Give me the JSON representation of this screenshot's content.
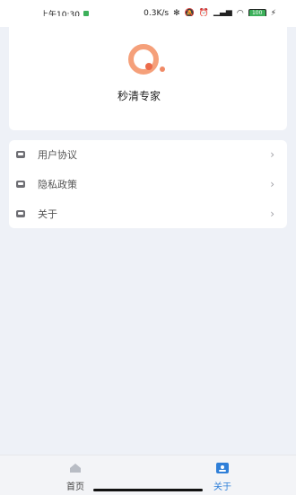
{
  "status_bar": {
    "time": "上午10:30",
    "net_speed": "0.3K/s",
    "battery": "100"
  },
  "app": {
    "name": "秒清专家",
    "brand_color": "#f5a07a"
  },
  "menu": {
    "items": [
      {
        "label": "用户协议",
        "icon": "document-icon"
      },
      {
        "label": "隐私政策",
        "icon": "document-icon"
      },
      {
        "label": "关于",
        "icon": "document-icon"
      }
    ],
    "chevron": "›"
  },
  "tabbar": {
    "tabs": [
      {
        "label": "首页",
        "icon": "home-icon",
        "active": false
      },
      {
        "label": "关于",
        "icon": "about-icon",
        "active": true
      }
    ],
    "active_color": "#2f7fd8",
    "inactive_color": "#444444"
  }
}
